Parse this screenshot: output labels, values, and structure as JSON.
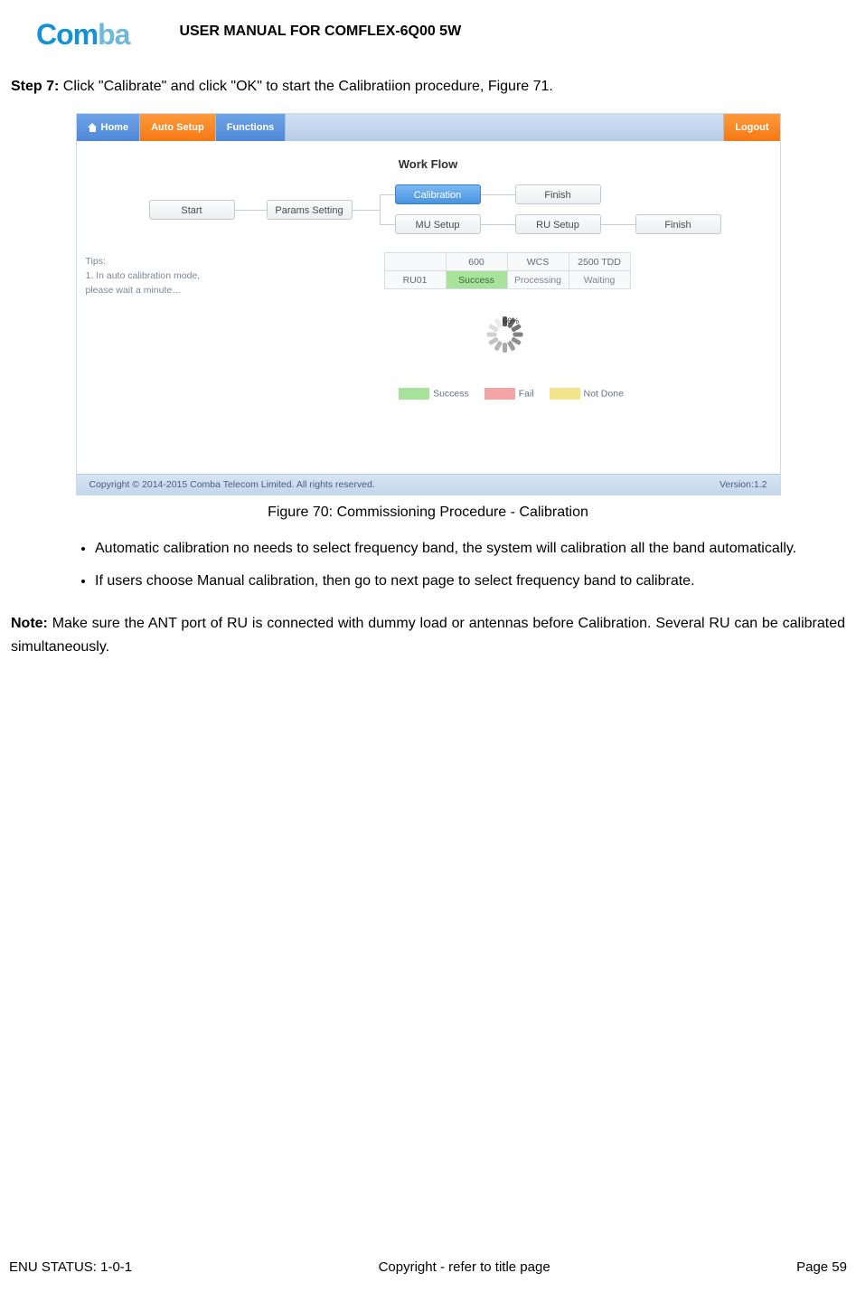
{
  "header": {
    "logo_a": "Com",
    "logo_b": "ba",
    "doc_title": "USER MANUAL FOR COMFLEX-6Q00 5W"
  },
  "step": {
    "label": "Step 7:",
    "text": " Click \"Calibrate\" and click \"OK\" to start the Calibratiion procedure, Figure 71."
  },
  "app": {
    "nav": {
      "home": "Home",
      "auto": "Auto Setup",
      "func": "Functions",
      "logout": "Logout"
    },
    "workflow_title": "Work Flow",
    "nodes": {
      "start": "Start",
      "params": "Params Setting",
      "calib": "Calibration",
      "finish1": "Finish",
      "mu": "MU Setup",
      "ru": "RU Setup",
      "finish2": "Finish"
    },
    "tips_title": "Tips:",
    "tips_body": "1. In auto calibration mode, please wait a minute…",
    "status_headers": [
      "",
      "600",
      "WCS",
      "2500 TDD"
    ],
    "status_row": [
      "RU01",
      "Success",
      "Processing",
      "Waiting"
    ],
    "spinner_pct": "66%",
    "legend": {
      "success": "Success",
      "fail": "Fail",
      "nd": "Not Done"
    },
    "copyright": "Copyright © 2014-2015 Comba Telecom Limited. All rights reserved.",
    "version": "Version:1.2"
  },
  "fig_caption": "Figure 70: Commissioning Procedure - Calibration",
  "bullets": [
    "Automatic calibration no needs to select frequency band, the system will calibration all the band automatically.",
    "If users choose Manual calibration, then go to next page to select frequency band to calibrate."
  ],
  "note_label": "Note:",
  "note_body": " Make sure the ANT port of RU is connected with dummy load or antennas before Calibration. Several RU can be calibrated simultaneously.",
  "footer": {
    "left": "ENU STATUS: 1-0-1",
    "center": "Copyright - refer to title page",
    "right": "Page 59"
  }
}
